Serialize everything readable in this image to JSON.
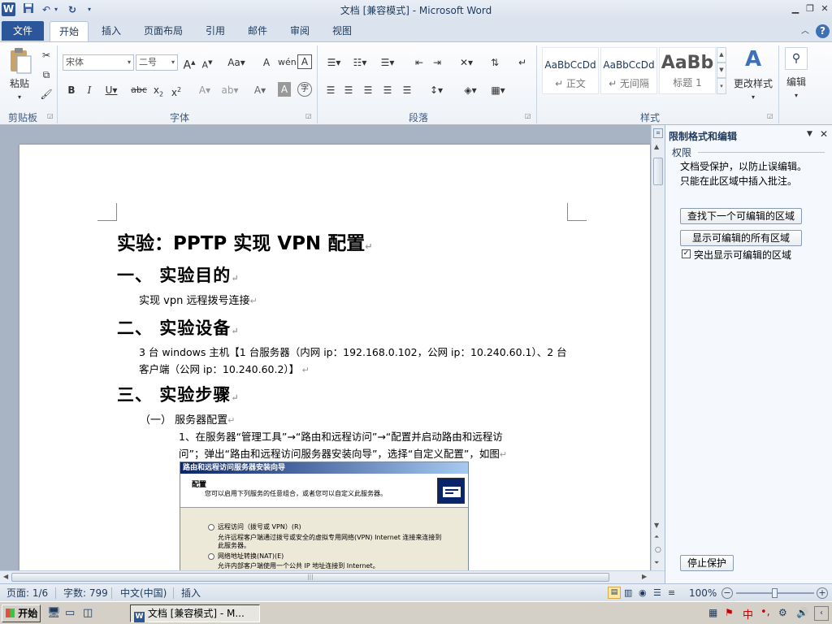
{
  "window": {
    "title": "文档 [兼容模式] - Microsoft Word"
  },
  "tabs": [
    {
      "label": "文件"
    },
    {
      "label": "开始"
    },
    {
      "label": "插入"
    },
    {
      "label": "页面布局"
    },
    {
      "label": "引用"
    },
    {
      "label": "邮件"
    },
    {
      "label": "审阅"
    },
    {
      "label": "视图"
    }
  ],
  "ribbon": {
    "clipboard": {
      "paste_label": "粘贴",
      "group_label": "剪贴板"
    },
    "font": {
      "font_name": "宋体",
      "font_size": "二号",
      "group_label": "字体"
    },
    "paragraph": {
      "group_label": "段落"
    },
    "styles": {
      "group_label": "样式",
      "items": [
        {
          "sample": "AaBbCcDd",
          "name": "↵ 正文"
        },
        {
          "sample": "AaBbCcDd",
          "name": "↵ 无间隔"
        },
        {
          "sample": "AaBb",
          "name": "标题 1"
        }
      ],
      "change_styles_label": "更改样式"
    },
    "editing": {
      "label": "编辑"
    }
  },
  "document": {
    "title": "实验：PPTP 实现 VPN 配置",
    "sec1_heading": "一、  实验目的",
    "sec1_body": "实现 vpn 远程拨号连接",
    "sec2_heading": "二、  实验设备",
    "sec2_body_line1": "3 台 windows 主机【1 台服务器（内网 ip：192.168.0.102，公网 ip：10.240.60.1）、2 台",
    "sec2_body_line2": "客户端（公网 ip：10.240.60.2）】",
    "sec3_heading": "三、  实验步骤",
    "sub1_heading": "（一）  服务器配置",
    "step1_line1": "1、在服务器“管理工具”→“路由和远程访问”→“配置并启动路由和远程访",
    "step1_line2": "问”；弹出“路由和远程访问服务器安装向导”，选择“自定义配置”，如图",
    "dialog": {
      "title": "路由和远程访问服务器安装向导",
      "heading": "配置",
      "subtitle": "您可以启用下列服务的任意组合，或者您可以自定义此服务器。",
      "opt1_label": "远程访问（拨号或 VPN）(R)",
      "opt1_desc_line1": "允许远程客户端通过拨号或安全的虚拟专用网络(VPN) Internet 连接来连接到",
      "opt1_desc_line2": "此服务器。",
      "opt2_label": "网络地址转换(NAT)(E)",
      "opt2_desc": "允许内部客户端使用一个公共 IP 地址连接到 Internet。"
    }
  },
  "pane": {
    "title": "限制格式和编辑",
    "section": "权限",
    "msg_line1": "文档受保护，以防止误编辑。",
    "msg_line2": "只能在此区域中插入批注。",
    "find_next_btn": "查找下一个可编辑的区域",
    "show_all_btn": "显示可编辑的所有区域",
    "highlight_label": "突出显示可编辑的区域",
    "stop_btn": "停止保护"
  },
  "status": {
    "page": "页面: 1/6",
    "words": "字数: 799",
    "language": "中文(中国)",
    "mode": "插入",
    "zoom": "100%"
  },
  "taskbar": {
    "start": "开始",
    "window_btn": "文档 [兼容模式] - M...",
    "tray": "中"
  }
}
